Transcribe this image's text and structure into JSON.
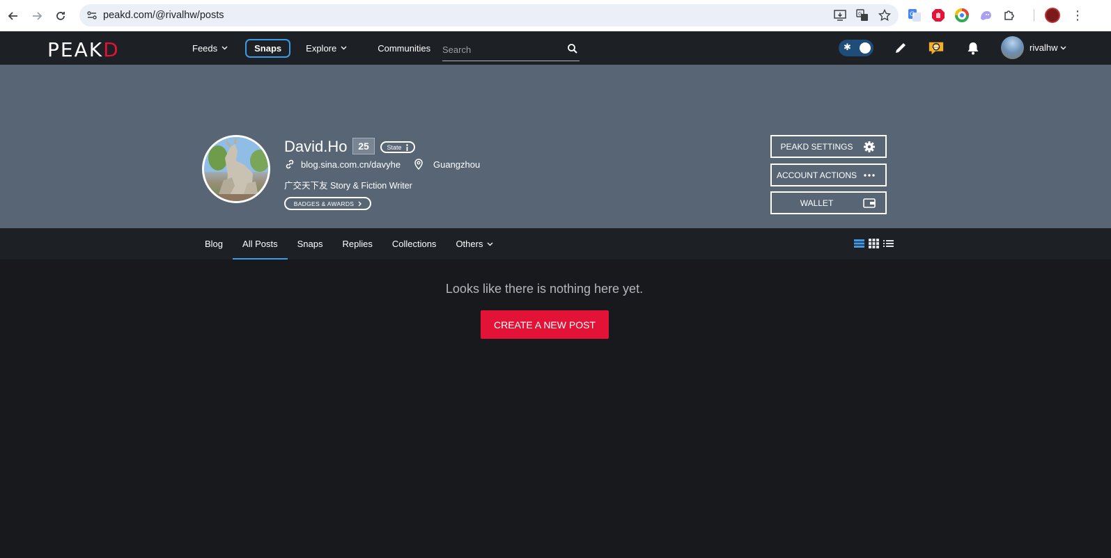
{
  "browser": {
    "url": "peakd.com/@rivalhw/posts"
  },
  "header": {
    "logo_text": "PEAK",
    "logo_accent": "D",
    "menu": {
      "feeds": "Feeds",
      "snaps": "Snaps",
      "explore": "Explore",
      "communities": "Communities"
    },
    "search_placeholder": "Search",
    "username": "rivalhw"
  },
  "profile": {
    "display_name": "David.Ho",
    "reputation": "25",
    "state_label": "State",
    "website": "blog.sina.com.cn/davyhe",
    "location": "Guangzhou",
    "about": "广交天下友 Story & Fiction Writer",
    "badges_label": "BADGES & AWARDS"
  },
  "actions": {
    "settings": "PEAKD SETTINGS",
    "account": "ACCOUNT ACTIONS",
    "wallet": "WALLET"
  },
  "tabs": {
    "blog": "Blog",
    "all_posts": "All Posts",
    "snaps": "Snaps",
    "replies": "Replies",
    "collections": "Collections",
    "others": "Others"
  },
  "main": {
    "empty_message": "Looks like there is nothing here yet.",
    "create_button": "CREATE A NEW POST"
  },
  "colors": {
    "brand_red": "#e31337",
    "accent_blue": "#3b9ce8",
    "cover_bg": "#586575",
    "header_bg": "#1d2024",
    "page_bg": "#18191c"
  }
}
